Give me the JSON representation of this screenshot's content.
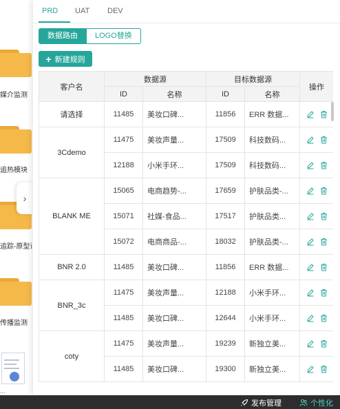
{
  "background": {
    "folders": [
      "媒介监测",
      "追热模块",
      "追踪-原型设",
      "传播监测"
    ],
    "document_label": "..."
  },
  "env_tabs": [
    "PRD",
    "UAT",
    "DEV"
  ],
  "env_active": "PRD",
  "segment": {
    "left": "数据路由",
    "right": "LOGO替换"
  },
  "add_button": "新建规则",
  "table": {
    "headers": {
      "customer": "客户名",
      "source_group": "数据源",
      "target_group": "目标数据源",
      "actions": "操作",
      "id": "ID",
      "name": "名称"
    },
    "groups": [
      {
        "customer": "请选择",
        "rows": [
          {
            "src_id": "11485",
            "src_name": "美妆口碑...",
            "tgt_id": "11856",
            "tgt_name": "ERR 数据..."
          }
        ]
      },
      {
        "customer": "3Cdemo",
        "rows": [
          {
            "src_id": "11475",
            "src_name": "美妆声量...",
            "tgt_id": "17509",
            "tgt_name": "科技数码..."
          },
          {
            "src_id": "12188",
            "src_name": "小米手环...",
            "tgt_id": "17509",
            "tgt_name": "科技数码..."
          }
        ]
      },
      {
        "customer": "BLANK ME",
        "rows": [
          {
            "src_id": "15065",
            "src_name": "电商趋势-...",
            "tgt_id": "17659",
            "tgt_name": "护肤品类-..."
          },
          {
            "src_id": "15071",
            "src_name": "社媒-食品...",
            "tgt_id": "17517",
            "tgt_name": "护肤品类..."
          },
          {
            "src_id": "15072",
            "src_name": "电商商品-...",
            "tgt_id": "18032",
            "tgt_name": "护肤品类-..."
          }
        ]
      },
      {
        "customer": "BNR 2.0",
        "rows": [
          {
            "src_id": "11485",
            "src_name": "美妆口碑...",
            "tgt_id": "11856",
            "tgt_name": "ERR 数据..."
          }
        ]
      },
      {
        "customer": "BNR_3c",
        "rows": [
          {
            "src_id": "11475",
            "src_name": "美妆声量...",
            "tgt_id": "12188",
            "tgt_name": "小米手环..."
          },
          {
            "src_id": "11485",
            "src_name": "美妆口碑...",
            "tgt_id": "12644",
            "tgt_name": "小米手环..."
          }
        ]
      },
      {
        "customer": "coty",
        "rows": [
          {
            "src_id": "11475",
            "src_name": "美妆声量...",
            "tgt_id": "19239",
            "tgt_name": "新独立美..."
          },
          {
            "src_id": "11485",
            "src_name": "美妆口碑...",
            "tgt_id": "19300",
            "tgt_name": "新独立美..."
          }
        ]
      }
    ]
  },
  "bottom_bar": {
    "publish": "发布管理",
    "personalize": "个性化"
  },
  "colors": {
    "accent": "#26a69a",
    "bar": "#2d2d2d",
    "folder": "#f5b94a"
  },
  "icons": {
    "edit": "edit-icon",
    "delete": "trash-icon",
    "publish": "rocket-icon",
    "personalize": "people-icon",
    "collapse": "chevron-right-icon"
  }
}
